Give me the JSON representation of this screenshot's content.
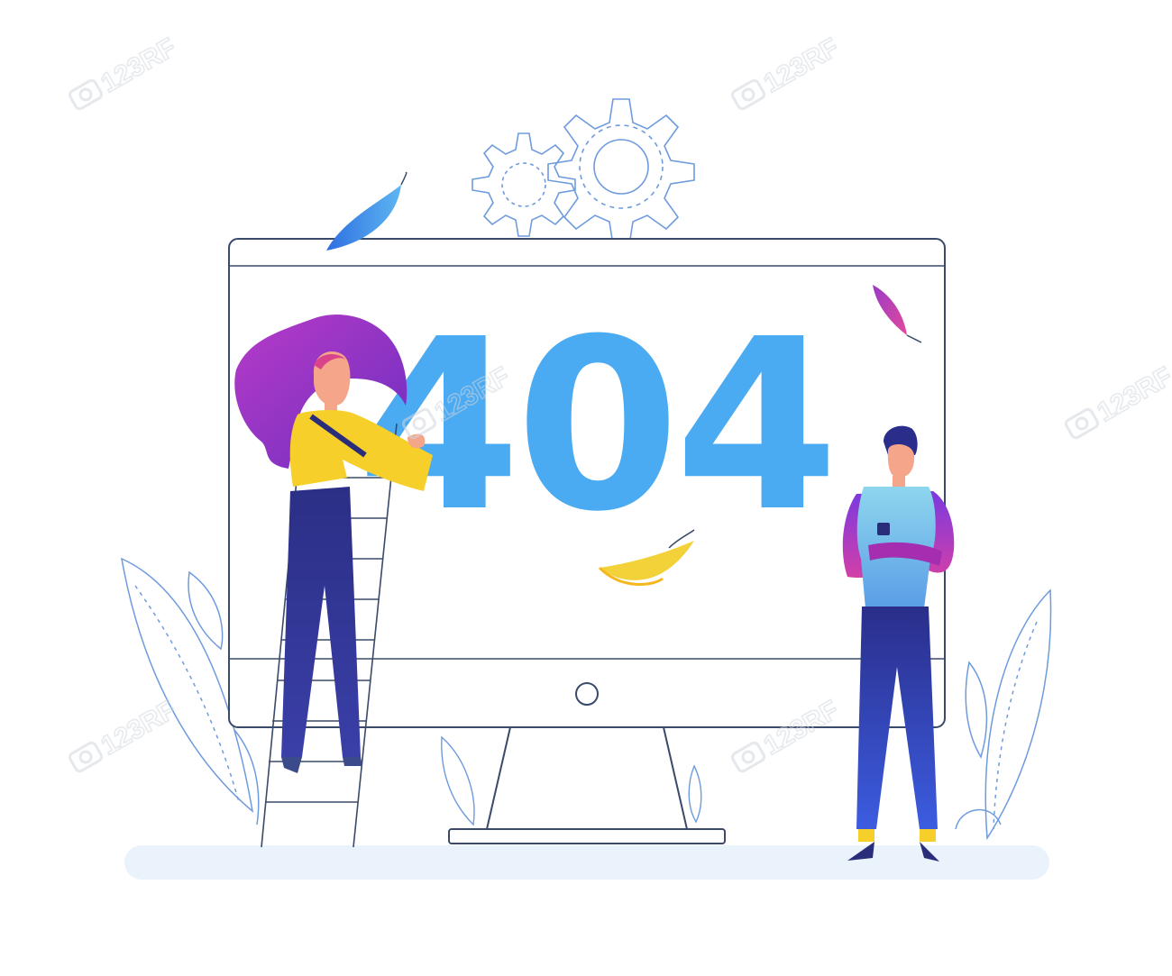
{
  "error": {
    "code": "404"
  },
  "watermark": {
    "text": "123RF"
  },
  "colors": {
    "error_blue": "#4AAAF2",
    "outline_blue": "#5A8CD8",
    "outline_dark": "#3A4A6A",
    "ground": "#EAF2FC",
    "hair_purple": "#B83AC8",
    "sweater_yellow": "#F6CF2A",
    "overalls_navy": "#2A2E7A",
    "vest_blue": "#6EC0EA",
    "sleeve_magenta": "#A42DB0",
    "pants_blue": "#2B3FB8",
    "leaf_blue": "#3F84E2",
    "leaf_pink": "#C845B0",
    "leaf_yellow": "#F2D238"
  },
  "icons": [
    "gear-icon",
    "leaf-icon",
    "power-button-icon",
    "ladder-icon",
    "plant-icon",
    "watermark-camera-icon"
  ]
}
